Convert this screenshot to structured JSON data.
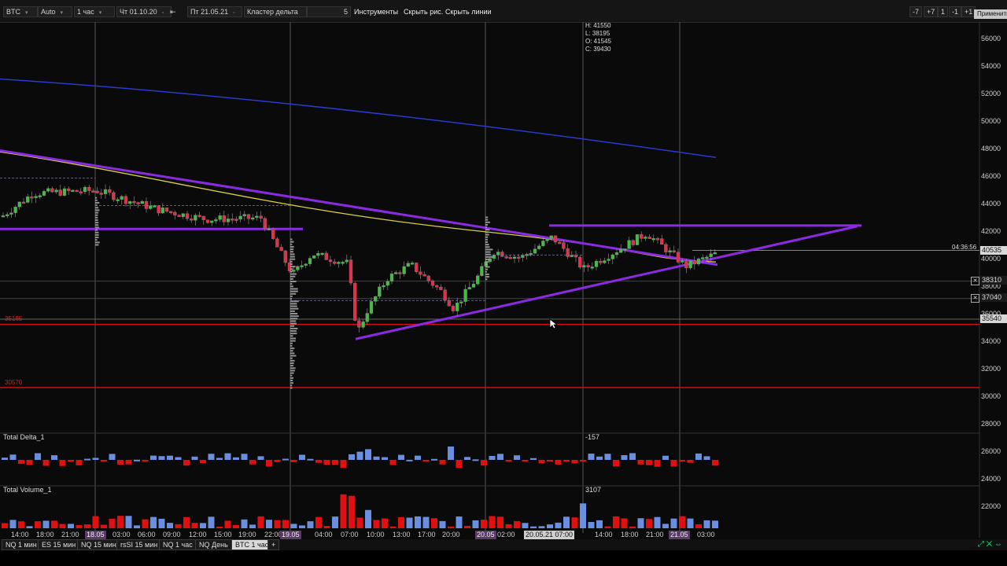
{
  "toolbar": {
    "instrument": "BTC",
    "scale": "Auto",
    "timeframe": "1 час",
    "date_from": "Чт 01.10.20",
    "date_to": "Пт 21.05.21",
    "mode": "Кластер дельта",
    "cluster_value": "5",
    "instruments_label": "Инструменты",
    "hide_drawings_label": "Скрыть рис.",
    "hide_lines_label": "Скрыть линии",
    "right_buttons": [
      "-7",
      "+7",
      "1",
      "-1",
      "+1"
    ],
    "apply_label": "Применить"
  },
  "ohlc": {
    "h": "H: 41550",
    "l": "L: 38195",
    "o": "O: 41545",
    "c": "C: 39430"
  },
  "price_axis": [
    "56000",
    "54000",
    "52000",
    "50000",
    "48000",
    "46000",
    "44000",
    "42000",
    "40000",
    "38000",
    "36000",
    "34000",
    "32000",
    "30000",
    "28000",
    "26000",
    "24000",
    "22000"
  ],
  "price_tags": [
    {
      "value": "40535",
      "color": "#d8d8d8",
      "text_color": "#111"
    },
    {
      "value": "38310",
      "color": "#1a1a1a",
      "text_color": "#ddd"
    },
    {
      "value": "37040",
      "color": "#1a1a1a",
      "text_color": "#ddd"
    },
    {
      "value": "35540",
      "color": "#d8d8d8",
      "text_color": "#111"
    }
  ],
  "time_tag": "04:36:56",
  "levels": [
    {
      "label": "35165"
    },
    {
      "label": "30570"
    }
  ],
  "subcharts": {
    "delta": {
      "label": "Total Delta_1",
      "value": "-157"
    },
    "volume": {
      "label": "Total Volume_1",
      "value": "3107"
    }
  },
  "time_axis": [
    {
      "label": "14:00",
      "style": ""
    },
    {
      "label": "18:00",
      "style": ""
    },
    {
      "label": "21:00",
      "style": ""
    },
    {
      "label": "18.05",
      "style": "hl"
    },
    {
      "label": "03:00",
      "style": ""
    },
    {
      "label": "06:00",
      "style": ""
    },
    {
      "label": "09:00",
      "style": ""
    },
    {
      "label": "12:00",
      "style": ""
    },
    {
      "label": "15:00",
      "style": ""
    },
    {
      "label": "19:00",
      "style": ""
    },
    {
      "label": "22:00",
      "style": ""
    },
    {
      "label": "19.05",
      "style": "hl"
    },
    {
      "label": "04:00",
      "style": ""
    },
    {
      "label": "07:00",
      "style": ""
    },
    {
      "label": "10:00",
      "style": ""
    },
    {
      "label": "13:00",
      "style": ""
    },
    {
      "label": "17:00",
      "style": ""
    },
    {
      "label": "20:00",
      "style": ""
    },
    {
      "label": "20.05",
      "style": "hl"
    },
    {
      "label": "02:00",
      "style": ""
    },
    {
      "label": "20.05.21 07:00",
      "style": "cur"
    },
    {
      "label": "14:00",
      "style": ""
    },
    {
      "label": "18:00",
      "style": ""
    },
    {
      "label": "21:00",
      "style": ""
    },
    {
      "label": "21.05",
      "style": "hl"
    },
    {
      "label": "03:00",
      "style": ""
    }
  ],
  "tabs": [
    "NQ 1 мин",
    "ES 15 мин",
    "NQ 15 мин",
    "rsSI 15 мин",
    "NQ 1 час",
    "NQ День",
    "BTC 1 час",
    "+"
  ],
  "active_tab": 6,
  "colors": {
    "bull": "#44bb44",
    "bear": "#e0304a",
    "delta_pos": "#6a8fe0",
    "delta_neg": "#e01010",
    "trend": "#8a2be2",
    "ma_blue": "#2a3ad0",
    "ma_yellow": "#d8d040",
    "level": "#d01010"
  }
}
